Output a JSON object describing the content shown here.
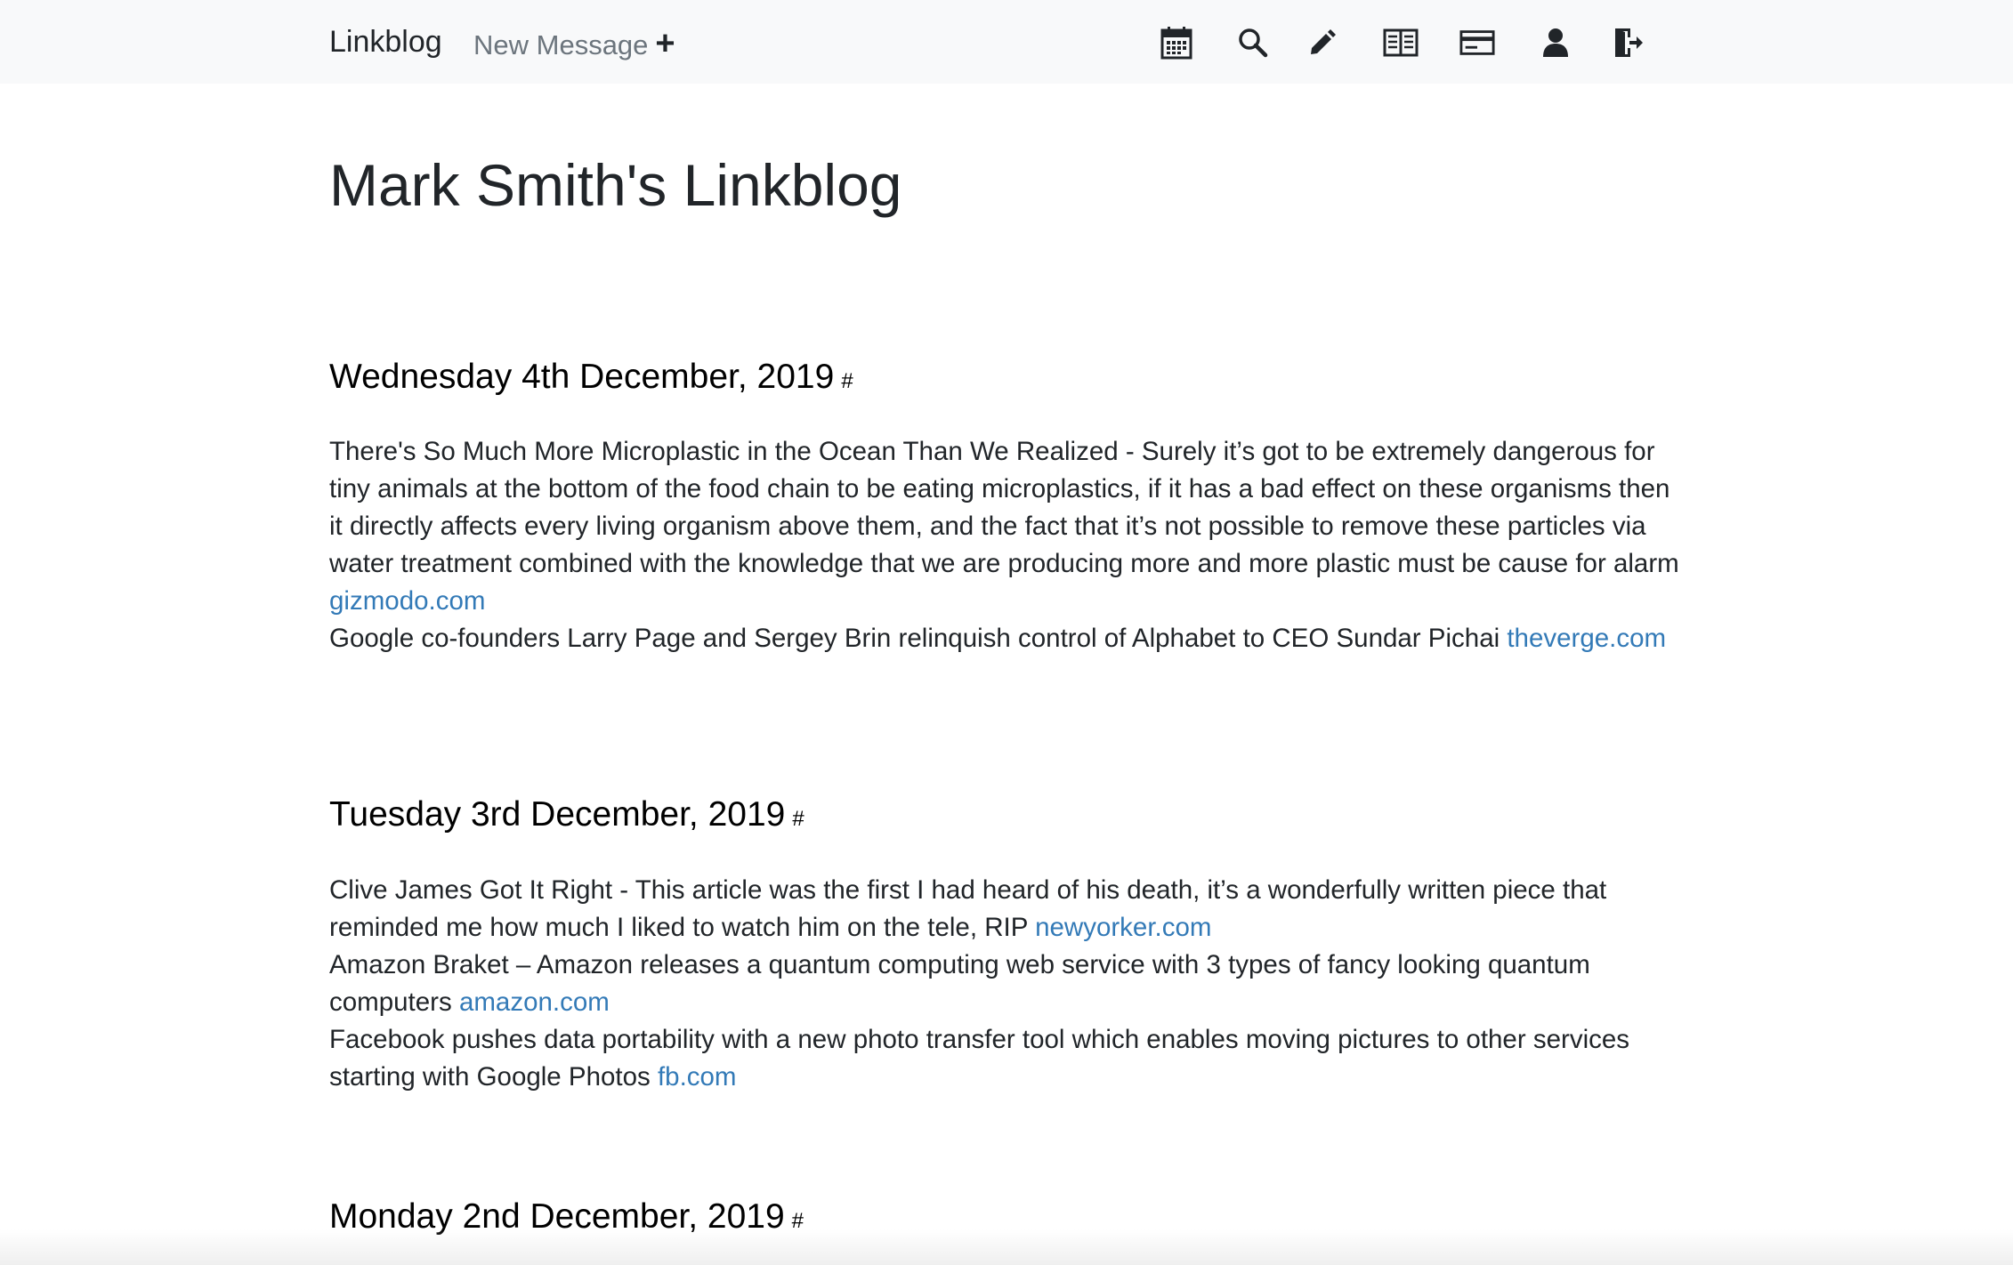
{
  "navbar": {
    "brand": "Linkblog",
    "new_message": "New Message",
    "new_message_icon": "plus-icon",
    "icons": [
      "calendar-icon",
      "search-icon",
      "pencil-icon",
      "book-open-icon",
      "credit-card-icon",
      "user-icon",
      "logout-icon"
    ]
  },
  "page": {
    "title": "Mark Smith's Linkblog"
  },
  "days": [
    {
      "heading": "Wednesday 4th December, 2019",
      "hash": "#",
      "entries": [
        {
          "text": "There's So Much More Microplastic in the Ocean Than We Realized - Surely it’s got to be extremely dangerous for tiny animals at the bottom of the food chain to be eating microplastics, if it has a bad effect on these organisms then it directly affects every living organism above them, and the fact that it’s not possible to remove these particles via water treatment combined with the knowledge that we are producing more and more plastic must be cause for alarm",
          "link": "gizmodo.com"
        },
        {
          "text": "Google co-founders Larry Page and Sergey Brin relinquish control of Alphabet to CEO Sundar Pichai",
          "link": "theverge.com"
        }
      ]
    },
    {
      "heading": "Tuesday 3rd December, 2019",
      "hash": "#",
      "entries": [
        {
          "text": "Clive James Got It Right - This article was the first I had heard of his death, it’s a wonderfully written piece that reminded me how much I liked to watch him on the tele, RIP",
          "link": "newyorker.com"
        },
        {
          "text": "Amazon Braket – Amazon releases a quantum computing web service with 3 types of fancy looking quantum computers",
          "link": "amazon.com"
        },
        {
          "text": "Facebook pushes data portability with a new photo transfer tool which enables moving pictures to other services starting with Google Photos",
          "link": "fb.com"
        }
      ]
    },
    {
      "heading": "Monday 2nd December, 2019",
      "hash": "#",
      "entries": []
    }
  ]
}
